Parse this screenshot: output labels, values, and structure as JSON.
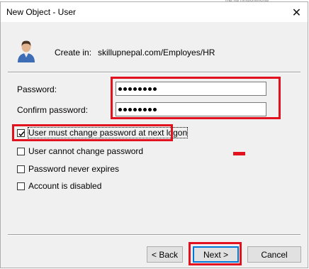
{
  "window": {
    "title": "New Object - User",
    "background_fragment": "roe ne unresponsive",
    "close_glyph": "✕"
  },
  "header": {
    "create_in_label": "Create in:",
    "create_in_path": "skillupnepal.com/Employes/HR",
    "icon": "user-icon"
  },
  "fields": {
    "password_label": "Password:",
    "password_masked_length": 8,
    "confirm_label": "Confirm password:",
    "confirm_masked_length": 8
  },
  "options": [
    {
      "label": "User must change password at next logon",
      "checked": true
    },
    {
      "label": "User cannot change password",
      "checked": false
    },
    {
      "label": "Password never expires",
      "checked": false
    },
    {
      "label": "Account is disabled",
      "checked": false
    }
  ],
  "buttons": {
    "back": "< Back",
    "next": "Next >",
    "cancel": "Cancel"
  },
  "colors": {
    "highlight": "#e3101d",
    "default_button_border": "#0078d7",
    "dialog_background": "#f0f0f0"
  }
}
